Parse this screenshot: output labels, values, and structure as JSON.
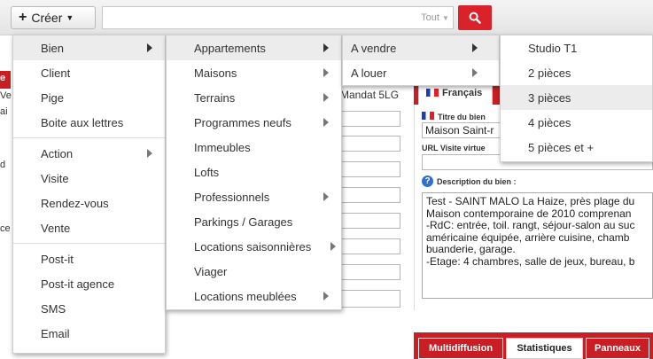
{
  "toolbar": {
    "create_label": "Créer",
    "scope_label": "Tout"
  },
  "background": {
    "mandat_label": "Mandat 5LG",
    "lang_tab": "Français",
    "title_label": "Titre du bien",
    "title_value": "Maison Saint-r",
    "url_label": "URL Visite virtue",
    "description_label": "Description du bien :",
    "description_lines": [
      "Test - SAINT MALO La Haize, près plage du",
      "Maison contemporaine de 2010 comprenan",
      "-RdC: entrée, toil. rangt, séjour-salon au suc",
      "américaine équipée, arrière cuisine, chamb",
      "buanderie, garage.",
      "-Etage: 4 chambres, salle de jeux, bureau, b"
    ],
    "bottom_tabs": [
      "Multidiffusion",
      "Statistiques",
      "Panneaux"
    ],
    "left_labels": [
      "e",
      "Ve",
      "ai",
      "d",
      "ce"
    ]
  },
  "menus": {
    "main": {
      "items": [
        {
          "label": "Bien",
          "submenu": true,
          "active": true
        },
        {
          "label": "Client"
        },
        {
          "label": "Pige"
        },
        {
          "label": "Boite aux lettres"
        }
      ],
      "items2": [
        {
          "label": "Action",
          "submenu": true
        },
        {
          "label": "Visite"
        },
        {
          "label": "Rendez-vous"
        },
        {
          "label": "Vente"
        }
      ],
      "items3": [
        {
          "label": "Post-it"
        },
        {
          "label": "Post-it agence"
        },
        {
          "label": "SMS"
        },
        {
          "label": "Email"
        }
      ]
    },
    "bien": {
      "items": [
        {
          "label": "Appartements",
          "submenu": true,
          "active": true
        },
        {
          "label": "Maisons",
          "submenu": true
        },
        {
          "label": "Terrains",
          "submenu": true
        },
        {
          "label": "Programmes neufs",
          "submenu": true
        },
        {
          "label": "Immeubles"
        },
        {
          "label": "Lofts"
        },
        {
          "label": "Professionnels",
          "submenu": true
        },
        {
          "label": "Parkings / Garages"
        },
        {
          "label": "Locations saisonnières",
          "submenu": true
        },
        {
          "label": "Viager"
        },
        {
          "label": "Locations meublées",
          "submenu": true
        }
      ]
    },
    "appartements": {
      "items": [
        {
          "label": "A vendre",
          "submenu": true,
          "active": true
        },
        {
          "label": "A louer",
          "submenu": true
        }
      ]
    },
    "a_vendre": {
      "items": [
        {
          "label": "Studio T1"
        },
        {
          "label": "2 pièces"
        },
        {
          "label": "3 pièces",
          "active": true
        },
        {
          "label": "4 pièces"
        },
        {
          "label": "5 pièces et +"
        }
      ]
    }
  },
  "colors": {
    "accent": "#d9222a",
    "menu_highlight": "#ececec"
  },
  "icons": {
    "create": "plus-icon",
    "search": "magnifier-icon",
    "submenu": "triangle-right-icon",
    "info": "info-circle-icon"
  }
}
